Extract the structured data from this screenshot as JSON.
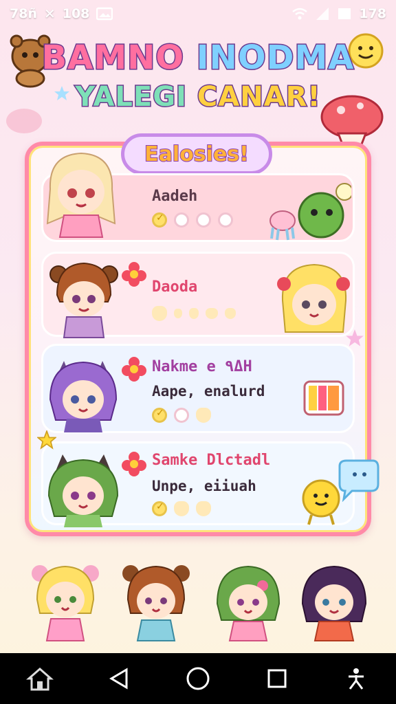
{
  "status_bar": {
    "left_text": "78ñ",
    "left_number": "108",
    "right_text": "178",
    "icons": [
      "fan-icon",
      "image-icon",
      "wifi-icon",
      "signal-icon",
      "battery-icon"
    ]
  },
  "title": {
    "line1_a": "BAMNO",
    "line1_b": "INODMA",
    "line2_a": "YALEGI",
    "line2_b": "CANAR!"
  },
  "panel": {
    "badge": "Ealosies!"
  },
  "cards": [
    {
      "name": "Aadeh",
      "sub": "",
      "progress": 1,
      "total": 4,
      "name_color": "#5a3a4a"
    },
    {
      "name": "Daoda",
      "sub": "",
      "progress": 0,
      "total": 5,
      "name_color": "#e0466e"
    },
    {
      "name": "Nakme e ٩ΔH",
      "sub": "Aape, enalurd",
      "progress": 1,
      "total": 3,
      "name_color": "#a23fa0"
    },
    {
      "name": "Samke Dlctadl",
      "sub": "Unpe, eiiuah",
      "progress": 1,
      "total": 3,
      "name_color": "#e0466e"
    }
  ],
  "colors": {
    "panel_border": "#ff8aa8",
    "title_stroke": "#6b3a8e",
    "badge_border": "#c88be8"
  },
  "nav": {
    "buttons": [
      "home-icon",
      "back-icon",
      "circle-home-icon",
      "recents-icon",
      "accessibility-icon"
    ]
  }
}
